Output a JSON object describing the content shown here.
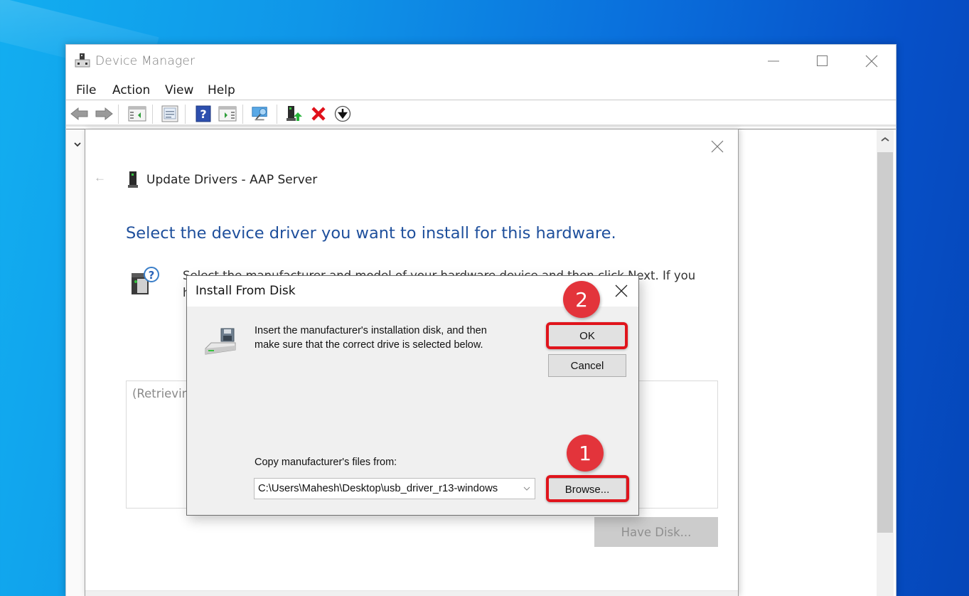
{
  "desktop": {
    "background_color": "#0f8fe6"
  },
  "device_manager": {
    "title": "Device Manager",
    "title_icon": "device-manager-icon",
    "window_controls": [
      "minimize",
      "maximize",
      "close"
    ],
    "menu": [
      {
        "label": "File"
      },
      {
        "label": "Action"
      },
      {
        "label": "View"
      },
      {
        "label": "Help"
      }
    ],
    "toolbar": [
      {
        "icon": "back-arrow-icon",
        "label": "Back"
      },
      {
        "icon": "forward-arrow-icon",
        "label": "Forward"
      },
      {
        "icon": "show-hide-console-tree-icon",
        "label": "Show/Hide Console Tree"
      },
      {
        "icon": "properties-icon",
        "label": "Properties"
      },
      {
        "icon": "help-icon",
        "label": "Help"
      },
      {
        "icon": "show-hide-action-pane-icon",
        "label": "Show/Hide Action Pane"
      },
      {
        "icon": "scan-hardware-icon",
        "label": "Scan for hardware changes"
      },
      {
        "icon": "update-driver-icon",
        "label": "Update driver"
      },
      {
        "icon": "uninstall-device-icon",
        "label": "Uninstall device"
      },
      {
        "icon": "enable-device-icon",
        "label": "Enable device"
      }
    ]
  },
  "update_drivers": {
    "back_glyph": "←",
    "title": "Update Drivers - AAP Server",
    "heading": "Select the device driver you want to install for this hardware.",
    "instructions": "Select the manufacturer and model of your hardware device and then click Next. If you have a disk that contains the driver you want to install, click Have Disk.",
    "list_placeholder": "(Retrieving a list of all devices)",
    "have_disk_label": "Have Disk...",
    "accent_color": "#1e4f9c"
  },
  "install_from_disk": {
    "title": "Install From Disk",
    "message_line1": "Insert the manufacturer's installation disk, and then",
    "message_line2": "make sure that the correct drive is selected below.",
    "ok_label": "OK",
    "cancel_label": "Cancel",
    "copy_label": "Copy manufacturer's files from:",
    "path_value": "C:\\Users\\Mahesh\\Desktop\\usb_driver_r13-windows",
    "browse_label": "Browse..."
  },
  "annotations": {
    "highlight_color": "#e0141c",
    "steps": [
      {
        "number": "1",
        "target": "Browse..."
      },
      {
        "number": "2",
        "target": "OK"
      }
    ]
  }
}
